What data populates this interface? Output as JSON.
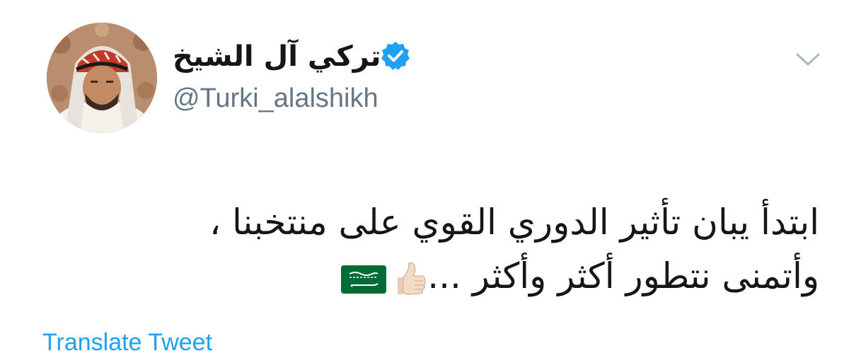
{
  "user": {
    "display_name": "تركي آل الشيخ",
    "handle": "@Turki_alalshikh",
    "verified": true,
    "avatar_icon": "profile-photo"
  },
  "tweet": {
    "line1": "ابتدأ يبان تأثير الدوري القوي على منتخبنا ،",
    "line2": "وأتمنى نتطور أكثر وأكثر ...",
    "emojis": [
      "thumbs-up-light-skin-tone",
      "saudi-arabia-flag"
    ]
  },
  "actions": {
    "translate_label": "Translate Tweet"
  },
  "icons": {
    "menu": "chevron-down-icon",
    "verified": "verified-badge-icon"
  },
  "colors": {
    "verified": "#1da1f2",
    "link": "#1da1f2",
    "handle": "#657786",
    "text": "#14171a",
    "flag_green": "#006c35"
  }
}
